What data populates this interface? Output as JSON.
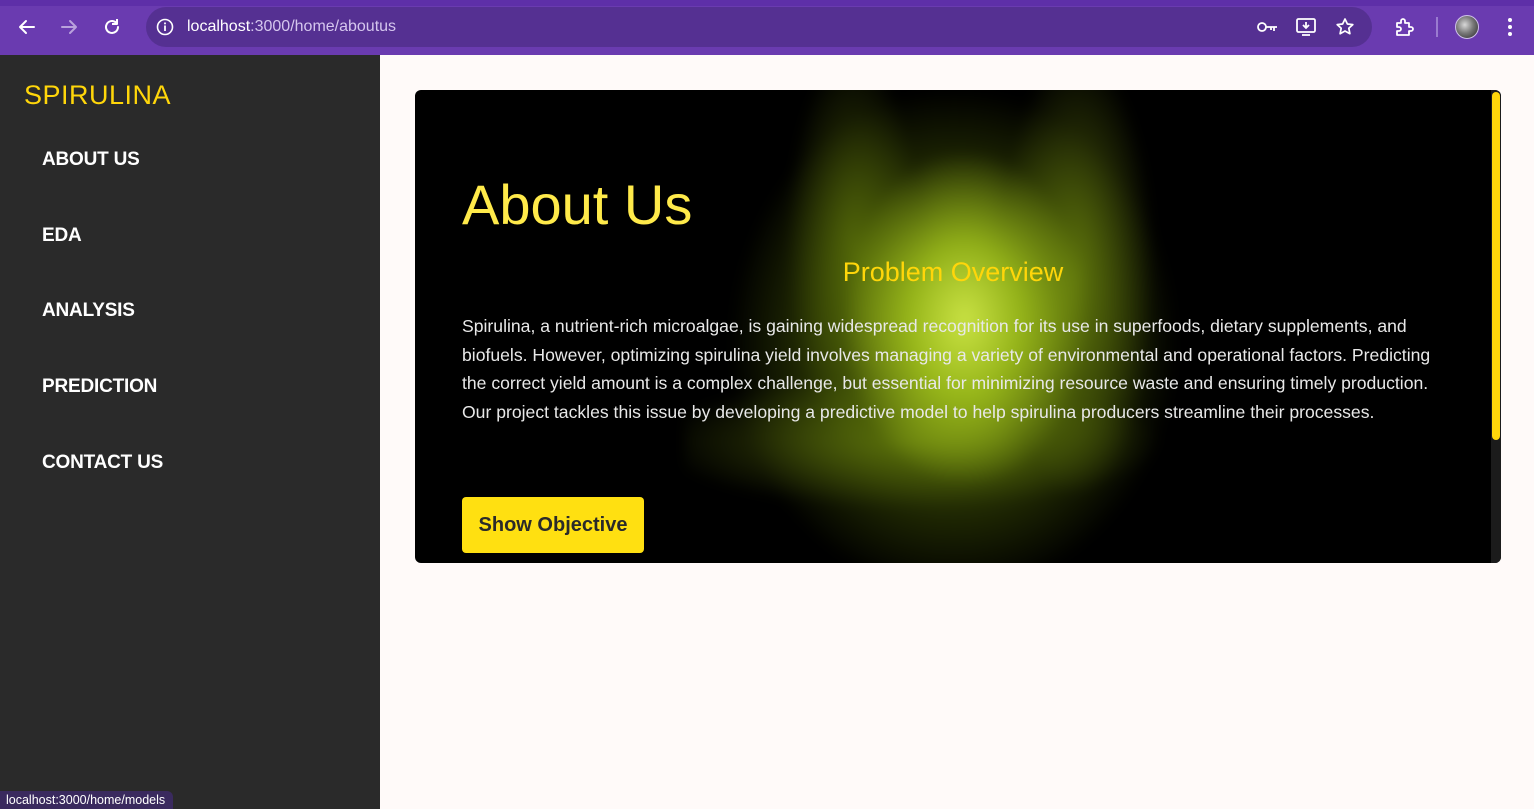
{
  "browser": {
    "url_host": "localhost",
    "url_path": ":3000/home/aboutus",
    "icons": [
      "back-icon",
      "forward-icon",
      "reload-icon",
      "site-info-icon",
      "password-key-icon",
      "install-app-icon",
      "bookmark-star-icon",
      "extensions-icon",
      "profile-avatar",
      "menu-kebab-icon"
    ],
    "status_link": "localhost:3000/home/models",
    "accent_color": "#6a3bb0"
  },
  "sidebar": {
    "brand": "SPIRULINA",
    "items": [
      {
        "label": "ABOUT US"
      },
      {
        "label": "EDA"
      },
      {
        "label": "ANALYSIS"
      },
      {
        "label": "PREDICTION"
      },
      {
        "label": "CONTACT US"
      }
    ],
    "brand_color": "#ffd60a"
  },
  "main": {
    "title": "About Us",
    "subtitle": "Problem Overview",
    "description": "Spirulina, a nutrient-rich microalgae, is gaining widespread recognition for its use in superfoods, dietary supplements, and biofuels. However, optimizing spirulina yield involves managing a variety of environmental and operational factors. Predicting the correct yield amount is a complex challenge, but essential for minimizing resource waste and ensuring timely production. Our project tackles this issue by developing a predictive model to help spirulina producers streamline their processes.",
    "button_label": "Show Objective",
    "button_color": "#ffe011"
  }
}
